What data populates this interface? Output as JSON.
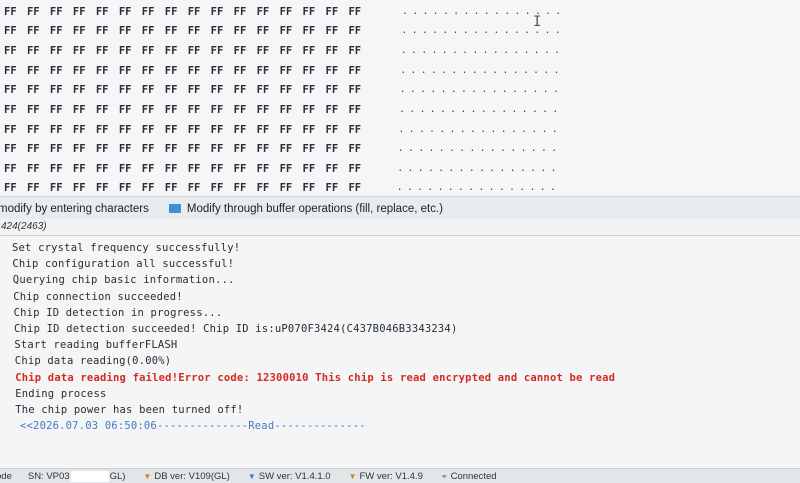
{
  "hex_view": {
    "rows": [
      {
        "bytes": "FF FF FF FF FF FF FF FF FF FF FF FF FF FF FF FF",
        "ascii": "................"
      },
      {
        "bytes": "FF FF FF FF FF FF FF FF FF FF FF FF FF FF FF FF",
        "ascii": "................"
      },
      {
        "bytes": "FF FF FF FF FF FF FF FF FF FF FF FF FF FF FF FF",
        "ascii": "................"
      },
      {
        "bytes": "FF FF FF FF FF FF FF FF FF FF FF FF FF FF FF FF",
        "ascii": "................"
      },
      {
        "bytes": "FF FF FF FF FF FF FF FF FF FF FF FF FF FF FF FF",
        "ascii": "................"
      },
      {
        "bytes": "FF FF FF FF FF FF FF FF FF FF FF FF FF FF FF FF",
        "ascii": "................"
      },
      {
        "bytes": "FF FF FF FF FF FF FF FF FF FF FF FF FF FF FF FF",
        "ascii": "................"
      },
      {
        "bytes": "FF FF FF FF FF FF FF FF FF FF FF FF FF FF FF FF",
        "ascii": "................"
      },
      {
        "bytes": "FF FF FF FF FF FF FF FF FF FF FF FF FF FF FF FF",
        "ascii": "................"
      },
      {
        "bytes": "FF FF FF FF FF FF FF FF FF FF FF FF FF FF FF FF",
        "ascii": "................"
      }
    ]
  },
  "mode_bar": {
    "option_chars": "modify by entering characters",
    "option_buffer": "Modify through buffer operations (fill, replace, etc.)",
    "option_buffer_color": "#3d8fd6"
  },
  "address_strip": {
    "text": "424(2463)"
  },
  "log": {
    "lines": [
      {
        "text": "Set crystal frequency successfully!",
        "kind": "info"
      },
      {
        "text": "Chip configuration all successful!",
        "kind": "info"
      },
      {
        "text": "Querying chip basic information...",
        "kind": "info"
      },
      {
        "text": "Chip connection succeeded!",
        "kind": "info"
      },
      {
        "text": "Chip ID detection in progress...",
        "kind": "info"
      },
      {
        "text": "Chip ID detection succeeded! Chip ID is:uP070F3424(C437B046B3343234)",
        "kind": "info"
      },
      {
        "text": "Start reading bufferFLASH",
        "kind": "info"
      },
      {
        "text": "Chip data reading(0.00%)",
        "kind": "info"
      },
      {
        "text": "Chip data reading failed!Error code: 12300010 This chip is read encrypted and cannot be read",
        "kind": "error"
      },
      {
        "text": "Ending process",
        "kind": "info"
      },
      {
        "text": "The chip power has been turned off!",
        "kind": "info"
      },
      {
        "text": "<<2026.07.03 06:50:06--------------Read--------------",
        "kind": "separator"
      }
    ],
    "error_color": "#d42a20",
    "separator_color": "#4a78c2"
  },
  "status_bar": {
    "mode_text": "ode",
    "sn_label": "SN: VP03",
    "sn_suffix": "GL)",
    "db_ver": "DB ver: V109(GL)",
    "sw_ver": "SW ver: V1.4.1.0",
    "fw_ver": "FW ver: V1.4.9",
    "connection": "Connected",
    "db_icon": "triangle-down-icon",
    "sw_icon": "triangle-down-icon",
    "fw_icon": "triangle-down-icon",
    "conn_icon": "link-icon"
  }
}
